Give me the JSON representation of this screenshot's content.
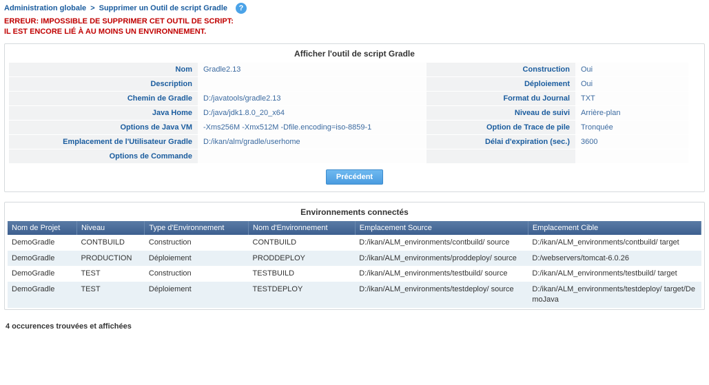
{
  "breadcrumb": {
    "root": "Administration globale",
    "current": "Supprimer un Outil de script Gradle"
  },
  "error": {
    "line1": "ERREUR: IMPOSSIBLE DE SUPPRIMER CET OUTIL DE SCRIPT:",
    "line2": "IL EST ENCORE LIÉ À AU MOINS UN ENVIRONNEMENT."
  },
  "panelTool": {
    "title": "Afficher l'outil de script Gradle",
    "labels": {
      "nom": "Nom",
      "description": "Description",
      "cheminGradle": "Chemin de Gradle",
      "javaHome": "Java Home",
      "javaVmOptions": "Options de Java VM",
      "gradleUserHome": "Emplacement de l'Utilisateur Gradle",
      "cmdOptions": "Options de Commande",
      "construction": "Construction",
      "deploiement": "Déploiement",
      "journalFormat": "Format du Journal",
      "niveauSuivi": "Niveau de suivi",
      "traceOption": "Option de Trace de pile",
      "delai": "Délai d'expiration (sec.)"
    },
    "values": {
      "nom": "Gradle2.13",
      "description": "",
      "cheminGradle": "D:/javatools/gradle2.13",
      "javaHome": "D:/java/jdk1.8.0_20_x64",
      "javaVmOptions": "-Xms256M -Xmx512M -Dfile.encoding=iso-8859-1",
      "gradleUserHome": "D:/ikan/alm/gradle/userhome",
      "cmdOptions": "",
      "construction": "Oui",
      "deploiement": "Oui",
      "journalFormat": "TXT",
      "niveauSuivi": "Arrière-plan",
      "traceOption": "Tronquée",
      "delai": "3600"
    },
    "buttons": {
      "back": "Précédent"
    }
  },
  "panelEnv": {
    "title": "Environnements connectés",
    "columns": {
      "projet": "Nom de Projet",
      "niveau": "Niveau",
      "type": "Type d'Environnement",
      "nomEnv": "Nom d'Environnement",
      "source": "Emplacement Source",
      "cible": "Emplacement Cible"
    },
    "rows": [
      {
        "projet": "DemoGradle",
        "niveau": "CONTBUILD",
        "type": "Construction",
        "nomEnv": "CONTBUILD",
        "source": "D:/ikan/ALM_environments/contbuild/ source",
        "cible": "D:/ikan/ALM_environments/contbuild/ target"
      },
      {
        "projet": "DemoGradle",
        "niveau": "PRODUCTION",
        "type": "Déploiement",
        "nomEnv": "PRODDEPLOY",
        "source": "D:/ikan/ALM_environments/proddeploy/ source",
        "cible": "D:/webservers/tomcat-6.0.26"
      },
      {
        "projet": "DemoGradle",
        "niveau": "TEST",
        "type": "Construction",
        "nomEnv": "TESTBUILD",
        "source": "D:/ikan/ALM_environments/testbuild/ source",
        "cible": "D:/ikan/ALM_environments/testbuild/ target"
      },
      {
        "projet": "DemoGradle",
        "niveau": "TEST",
        "type": "Déploiement",
        "nomEnv": "TESTDEPLOY",
        "source": "D:/ikan/ALM_environments/testdeploy/ source",
        "cible": "D:/ikan/ALM_environments/testdeploy/ target/DemoJava"
      }
    ],
    "footer": "4 occurences trouvées et affichées"
  }
}
